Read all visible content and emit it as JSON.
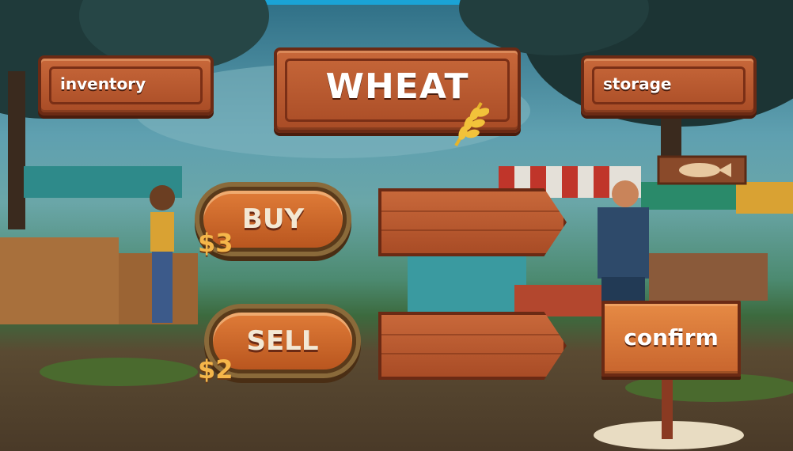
{
  "title": "WHEAT",
  "nav": {
    "inventory_label": "inventory",
    "storage_label": "storage"
  },
  "trade": {
    "buy_label": "BUY",
    "buy_price": "$3",
    "sell_label": "SELL",
    "sell_price": "$2",
    "buy_value": "",
    "sell_value": ""
  },
  "confirm_label": "confirm",
  "colors": {
    "wood": "#b9561f",
    "wood_dark": "#6b2a14",
    "price": "#f5b64a",
    "topbar": "#1aa3d6"
  },
  "icons": {
    "title": "wheat-icon",
    "stall_sign": "fish-icon"
  }
}
